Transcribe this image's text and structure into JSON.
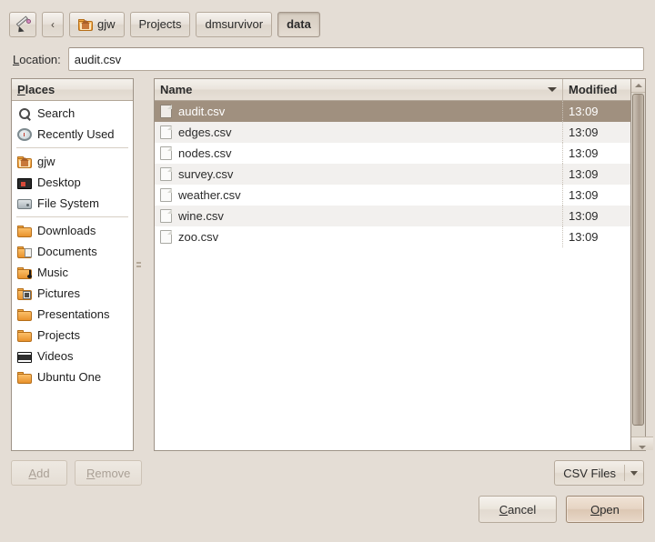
{
  "toolbar": {
    "type_filename_icon": "pencil-icon",
    "back_label": "‹",
    "breadcrumbs": [
      {
        "label": "gjw",
        "icon": "home-folder-icon",
        "active": false
      },
      {
        "label": "Projects",
        "icon": "",
        "active": false
      },
      {
        "label": "dmsurvivor",
        "icon": "",
        "active": false
      },
      {
        "label": "data",
        "icon": "",
        "active": true
      }
    ]
  },
  "location": {
    "label_pre": "",
    "label_mnemonic": "L",
    "label_post": "ocation:",
    "value": "audit.csv",
    "placeholder": ""
  },
  "places": {
    "header_mnemonic": "P",
    "header_post": "laces",
    "items": [
      {
        "label": "Search",
        "icon": "search-icon"
      },
      {
        "label": "Recently Used",
        "icon": "clock-icon"
      },
      {
        "separator": true
      },
      {
        "label": "gjw",
        "icon": "home-folder-icon"
      },
      {
        "label": "Desktop",
        "icon": "monitor-icon"
      },
      {
        "label": "File System",
        "icon": "drive-icon"
      },
      {
        "separator": true
      },
      {
        "label": "Downloads",
        "icon": "folder-icon"
      },
      {
        "label": "Documents",
        "icon": "folder-document-icon"
      },
      {
        "label": "Music",
        "icon": "folder-music-icon"
      },
      {
        "label": "Pictures",
        "icon": "folder-picture-icon"
      },
      {
        "label": "Presentations",
        "icon": "folder-icon"
      },
      {
        "label": "Projects",
        "icon": "folder-icon"
      },
      {
        "label": "Videos",
        "icon": "folder-video-icon"
      },
      {
        "label": "Ubuntu One",
        "icon": "folder-icon"
      }
    ],
    "add_label_mnemonic": "A",
    "add_label_post": "dd",
    "remove_label_mnemonic": "R",
    "remove_label_post": "emove",
    "add_enabled": false,
    "remove_enabled": false
  },
  "file_list": {
    "columns": [
      {
        "key": "name",
        "label": "Name",
        "sort_icon": "chevron-down-icon"
      },
      {
        "key": "modified",
        "label": "Modified"
      }
    ],
    "rows": [
      {
        "name": "audit.csv",
        "modified": "13:09",
        "icon": "file-icon",
        "selected": true
      },
      {
        "name": "edges.csv",
        "modified": "13:09",
        "icon": "file-icon",
        "selected": false
      },
      {
        "name": "nodes.csv",
        "modified": "13:09",
        "icon": "file-icon",
        "selected": false
      },
      {
        "name": "survey.csv",
        "modified": "13:09",
        "icon": "file-icon",
        "selected": false
      },
      {
        "name": "weather.csv",
        "modified": "13:09",
        "icon": "file-icon",
        "selected": false
      },
      {
        "name": "wine.csv",
        "modified": "13:09",
        "icon": "file-icon",
        "selected": false
      },
      {
        "name": "zoo.csv",
        "modified": "13:09",
        "icon": "file-icon",
        "selected": false
      }
    ]
  },
  "filter": {
    "selected": "CSV Files",
    "arrow_icon": "chevron-down-icon"
  },
  "actions": {
    "cancel_mnemonic": "C",
    "cancel_post": "ancel",
    "open_mnemonic": "O",
    "open_post": "pen",
    "default_button": "Open"
  },
  "colors": {
    "dialog_bg": "#e4ddd5",
    "selection_bg": "#a0907f",
    "selection_fg": "#ffffff",
    "row_alt_bg": "#f2f0ee",
    "pane_border": "#9e9387",
    "default_button_bg": "#e6d4c3"
  }
}
